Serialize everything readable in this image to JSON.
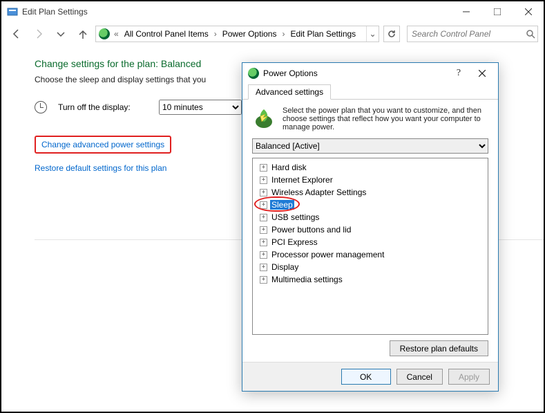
{
  "window": {
    "title": "Edit Plan Settings"
  },
  "breadcrumb": {
    "items": [
      "All Control Panel Items",
      "Power Options",
      "Edit Plan Settings"
    ]
  },
  "search": {
    "placeholder": "Search Control Panel"
  },
  "page": {
    "heading": "Change settings for the plan: Balanced",
    "sub": "Choose the sleep and display settings that you",
    "turn_off_label": "Turn off the display:",
    "turn_off_value": "10 minutes",
    "link_advanced": "Change advanced power settings",
    "link_restore": "Restore default settings for this plan"
  },
  "dialog": {
    "title": "Power Options",
    "tab": "Advanced settings",
    "intro": "Select the power plan that you want to customize, and then choose settings that reflect how you want your computer to manage power.",
    "plan_selected": "Balanced [Active]",
    "tree": [
      "Hard disk",
      "Internet Explorer",
      "Wireless Adapter Settings",
      "Sleep",
      "USB settings",
      "Power buttons and lid",
      "PCI Express",
      "Processor power management",
      "Display",
      "Multimedia settings"
    ],
    "highlight_index": 3,
    "restore_btn": "Restore plan defaults",
    "ok": "OK",
    "cancel": "Cancel",
    "apply": "Apply"
  }
}
